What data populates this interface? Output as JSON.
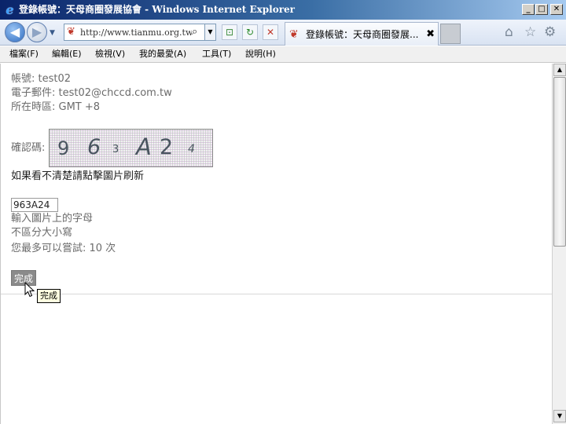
{
  "window": {
    "title": "登錄帳號：天母商圈發展協會 - Windows Internet Explorer",
    "minimize_glyph": "_",
    "maximize_glyph": "□",
    "close_glyph": "✕"
  },
  "nav": {
    "back_glyph": "◀",
    "forward_glyph": "▶",
    "dropdown_glyph": "▼",
    "url": "http://www.tianmu.org.tw/reg",
    "page_icon_glyph": "❦",
    "search_glyph": "⌕",
    "address_dropdown_glyph": "▼",
    "compat_glyph": "⊡",
    "refresh_glyph": "↻",
    "stop_glyph": "✕",
    "tab_label": "登錄帳號：天母商圈發展...",
    "tab_close_glyph": "✖",
    "home_glyph": "⌂",
    "favorites_glyph": "☆",
    "tools_glyph": "⚙"
  },
  "menu": [
    {
      "label": "檔案(F)"
    },
    {
      "label": "編輯(E)"
    },
    {
      "label": "檢視(V)"
    },
    {
      "label": "我的最愛(A)"
    },
    {
      "label": "工具(T)"
    },
    {
      "label": "說明(H)"
    }
  ],
  "account": {
    "username_line": "帳號: test02",
    "email_line": "電子郵件: test02@chccd.com.tw",
    "timezone_line": "所在時區: GMT +8"
  },
  "captcha": {
    "label": "確認碼:",
    "characters": [
      "9",
      "6",
      "3",
      "A",
      "2",
      "4"
    ],
    "refresh_hint": "如果看不清楚請點擊圖片刷新",
    "input_value": "963A24",
    "hint_letters": "輸入圖片上的字母",
    "hint_case": "不區分大小寫",
    "hint_attempts": "您最多可以嘗試: 10 次"
  },
  "form": {
    "submit_label": "完成",
    "tooltip": "完成"
  },
  "scrollbar": {
    "up_glyph": "▲",
    "down_glyph": "▼"
  },
  "colors": {
    "title_gradient_start": "#0a246a",
    "title_gradient_end": "#a6caf0",
    "submit_button": "#8b8b8b",
    "tooltip_bg": "#ffffe1"
  }
}
